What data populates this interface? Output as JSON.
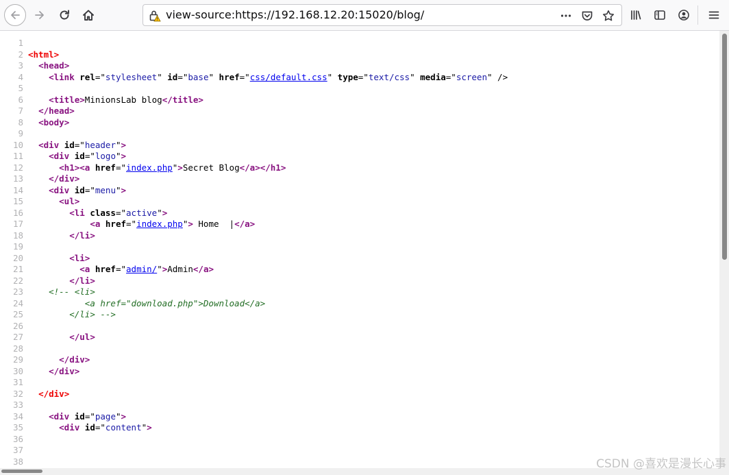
{
  "browser": {
    "url": "view-source:https://192.168.12.20:15020/blog/",
    "icons": {
      "back": "back-arrow-icon",
      "forward": "forward-arrow-icon",
      "reload": "reload-icon",
      "home": "home-icon",
      "site_info": "insecure-lock-warning-icon",
      "page_actions": "more-icon",
      "pocket": "pocket-icon",
      "bookmark": "star-icon",
      "library": "library-icon",
      "sidebar": "sidebar-icon",
      "account": "account-icon",
      "menu": "hamburger-menu-icon"
    },
    "colors": {
      "tag": "#881280",
      "error_tag": "#ee0000",
      "attr_value": "#1a1aa6",
      "link": "#0000ee",
      "comment": "#236e25",
      "line_number": "#b1b1b3"
    }
  },
  "source": {
    "lines": [
      {
        "n": "1"
      },
      {
        "n": "2"
      },
      {
        "n": "3"
      },
      {
        "n": "4"
      },
      {
        "n": "5"
      },
      {
        "n": "6"
      },
      {
        "n": "7"
      },
      {
        "n": "8"
      },
      {
        "n": "9"
      },
      {
        "n": "10"
      },
      {
        "n": "11"
      },
      {
        "n": "12"
      },
      {
        "n": "13"
      },
      {
        "n": "14"
      },
      {
        "n": "15"
      },
      {
        "n": "16"
      },
      {
        "n": "17"
      },
      {
        "n": "18"
      },
      {
        "n": "19"
      },
      {
        "n": "20"
      },
      {
        "n": "21"
      },
      {
        "n": "22"
      },
      {
        "n": "23"
      },
      {
        "n": "24"
      },
      {
        "n": "25"
      },
      {
        "n": "26"
      },
      {
        "n": "27"
      },
      {
        "n": "28"
      },
      {
        "n": "29"
      },
      {
        "n": "30"
      },
      {
        "n": "31"
      },
      {
        "n": "32"
      },
      {
        "n": "33"
      },
      {
        "n": "34"
      },
      {
        "n": "35"
      },
      {
        "n": "36"
      },
      {
        "n": "37"
      },
      {
        "n": "38"
      }
    ],
    "code": {
      "l2_html": "<html>",
      "l3_head": "<head>",
      "l4_link_open": "<link",
      "l4_rel": "rel",
      "l4_rel_val": "stylesheet",
      "l4_id": "id",
      "l4_id_val": "base",
      "l4_href": "href",
      "l4_href_val": "css/default.css",
      "l4_type": "type",
      "l4_type_val": "text/css",
      "l4_media": "media",
      "l4_media_val": "screen",
      "l4_close": "/>",
      "l6_title_open": "<title>",
      "l6_title_text": "MinionsLab blog",
      "l6_title_close": "</title>",
      "l7_head_close": "</head>",
      "l8_body": "<body>",
      "l10_div": "<div",
      "l10_id": "id",
      "l10_id_val": "header",
      "l11_div": "<div",
      "l11_id": "id",
      "l11_id_val": "logo",
      "l12_h1": "<h1>",
      "l12_a": "<a",
      "l12_href": "href",
      "l12_href_val": "index.php",
      "l12_text": "Secret Blog",
      "l12_a_close": "</a>",
      "l12_h1_close": "</h1>",
      "l13_div_close": "</div>",
      "l14_div": "<div",
      "l14_id": "id",
      "l14_id_val": "menu",
      "l15_ul": "<ul>",
      "l16_li": "<li",
      "l16_class": "class",
      "l16_class_val": "active",
      "l17_a": "<a",
      "l17_href": "href",
      "l17_href_val": "index.php",
      "l17_text": " Home  |",
      "l17_a_close": "</a>",
      "l18_li_close": "</li>",
      "l20_li": "<li>",
      "l21_a": "<a",
      "l21_href": "href",
      "l21_href_val": "admin/",
      "l21_text": "Admin",
      "l21_a_close": "</a>",
      "l22_li_close": "</li>",
      "l23_comment": "<!-- <li>",
      "l24_comment": "<a href=\"download.php\">Download</a>",
      "l25_comment": "</li> -->",
      "l27_ul_close": "</ul>",
      "l29_div_close": "</div>",
      "l30_div_close": "</div>",
      "l32_div_close": "</div>",
      "l34_div": "<div",
      "l34_id": "id",
      "l34_id_val": "page",
      "l35_div": "<div",
      "l35_id": "id",
      "l35_id_val": "content"
    }
  },
  "watermark": "CSDN @喜欢是漫长心事"
}
